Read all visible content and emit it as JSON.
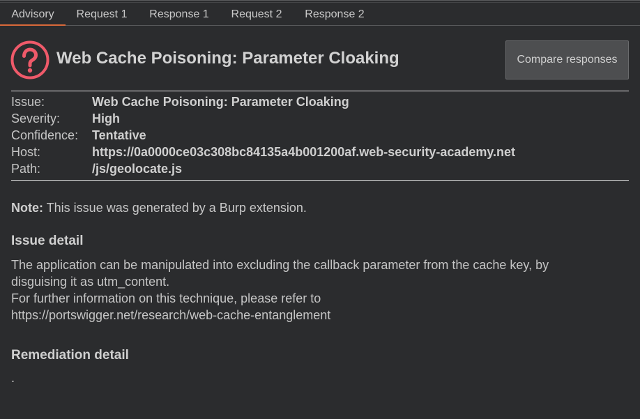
{
  "tabs": [
    {
      "label": "Advisory",
      "active": true
    },
    {
      "label": "Request 1",
      "active": false
    },
    {
      "label": "Response 1",
      "active": false
    },
    {
      "label": "Request 2",
      "active": false
    },
    {
      "label": "Response 2",
      "active": false
    }
  ],
  "header": {
    "icon": "question-circle-icon",
    "icon_color": "#ef5a6a",
    "title": "Web Cache Poisoning: Parameter Cloaking",
    "compare_button": "Compare responses"
  },
  "summary": {
    "issue_label": "Issue:",
    "issue_value": "Web Cache Poisoning: Parameter Cloaking",
    "severity_label": "Severity:",
    "severity_value": "High",
    "confidence_label": "Confidence:",
    "confidence_value": "Tentative",
    "host_label": "Host:",
    "host_value": "https://0a0000ce03c308bc84135a4b001200af.web-security-academy.net",
    "path_label": "Path:",
    "path_value": "/js/geolocate.js"
  },
  "note": {
    "label": "Note:",
    "text": " This issue was generated by a Burp extension."
  },
  "issue_detail": {
    "heading": "Issue detail",
    "lines": [
      "The application can be manipulated into excluding the callback parameter from the cache key, by",
      "disguising it as utm_content.",
      "For further information on this technique, please refer to",
      "https://portswigger.net/research/web-cache-entanglement"
    ]
  },
  "remediation": {
    "heading": "Remediation detail",
    "text": "."
  }
}
